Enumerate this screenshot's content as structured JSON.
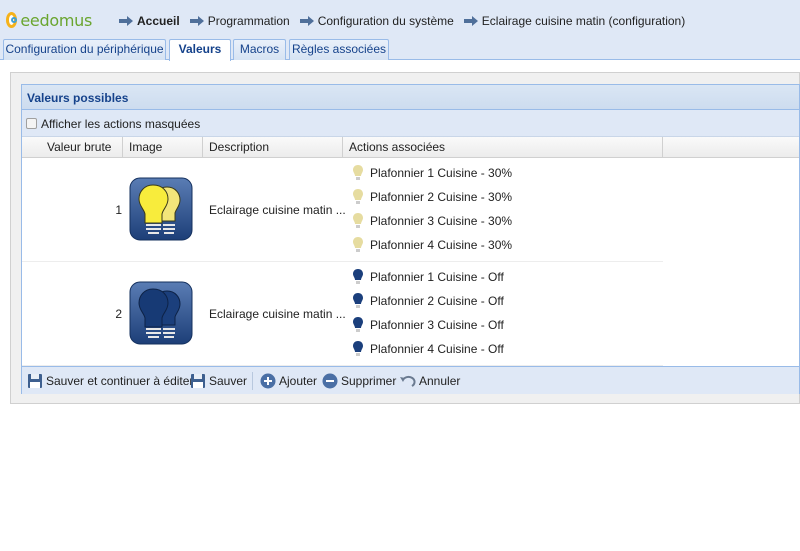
{
  "brand": {
    "name": "eedomus"
  },
  "breadcrumb": [
    {
      "label": "Accueil"
    },
    {
      "label": "Programmation"
    },
    {
      "label": "Configuration du système"
    },
    {
      "label": "Eclairage cuisine matin (configuration)"
    }
  ],
  "tabs": [
    {
      "label": "Configuration du périphérique",
      "active": false
    },
    {
      "label": "Valeurs",
      "active": true
    },
    {
      "label": "Macros",
      "active": false
    },
    {
      "label": "Règles associées",
      "active": false
    }
  ],
  "panel": {
    "title": "Valeurs possibles",
    "show_hidden_label": "Afficher les actions masquées",
    "show_hidden_checked": false
  },
  "columns": [
    "Valeur brute",
    "Image",
    "Description",
    "Actions associées"
  ],
  "rows": [
    {
      "raw": "1",
      "image_icon": "bulbs-on-icon",
      "description": "Eclairage cuisine matin ...",
      "actions": [
        "Plafonnier 1 Cuisine - 30%",
        "Plafonnier 2 Cuisine - 30%",
        "Plafonnier 3 Cuisine - 30%",
        "Plafonnier 4 Cuisine - 30%"
      ]
    },
    {
      "raw": "2",
      "image_icon": "bulbs-off-icon",
      "description": "Eclairage cuisine matin ...",
      "actions": [
        "Plafonnier 1 Cuisine - Off",
        "Plafonnier 2 Cuisine - Off",
        "Plafonnier 3 Cuisine - Off",
        "Plafonnier 4 Cuisine - Off"
      ]
    }
  ],
  "toolbar": {
    "save_continue": "Sauver et continuer à éditer",
    "save": "Sauver",
    "add": "Ajouter",
    "delete": "Supprimer",
    "cancel": "Annuler"
  },
  "colors": {
    "header_bg": "#dfe8f6",
    "title_blue": "#15428b",
    "bulb_on": "#f4e24a",
    "bulb_off": "#1b3f7c"
  }
}
